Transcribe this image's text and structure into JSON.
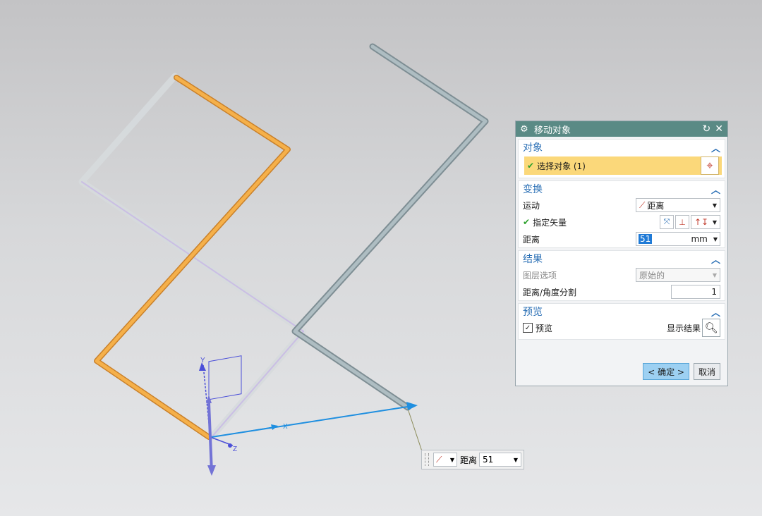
{
  "dialog": {
    "title": "移动对象",
    "reset_icon": "↻",
    "close_icon": "✕",
    "sections": {
      "object": {
        "header": "对象",
        "select_label": "选择对象 (1)"
      },
      "transform": {
        "header": "变换",
        "motion_label": "运动",
        "motion_value": "距离",
        "vector_label": "指定矢量",
        "distance_label": "距离",
        "distance_value": "51",
        "distance_unit": "mm"
      },
      "result": {
        "header": "结果",
        "layer_label": "图层选项",
        "layer_value": "原始的",
        "split_label": "距离/角度分割",
        "split_value": "1"
      },
      "preview": {
        "header": "预览",
        "preview_checkbox_label": "预览",
        "show_result_label": "显示结果"
      }
    },
    "buttons": {
      "ok": "< 确定 >",
      "cancel": "取消"
    }
  },
  "floating_handle": {
    "label": "距离",
    "value": "51"
  },
  "axes": {
    "x": "X",
    "y": "Y",
    "z": "Z"
  },
  "colors": {
    "titlebar": "#5a8a85",
    "selection": "#fbd87a",
    "orange_pipe": "#f0a23c",
    "gray_pipe": "#9fb0b6",
    "vector": "#1f8fe0"
  }
}
